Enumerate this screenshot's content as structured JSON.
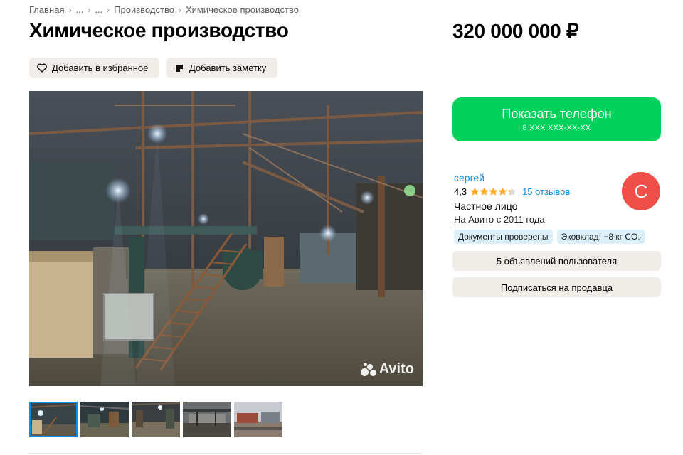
{
  "breadcrumb": {
    "items": [
      "Главная",
      "...",
      "...",
      "Производство",
      "Химическое производство"
    ],
    "separator": "›"
  },
  "listing": {
    "title": "Химическое производство",
    "price": "320 000 000 ₽"
  },
  "actions": {
    "favorite_label": "Добавить в избранное",
    "note_label": "Добавить заметку"
  },
  "gallery": {
    "watermark": "Avito",
    "thumbnail_count": 5,
    "active_index": 0
  },
  "contact": {
    "show_phone_label": "Показать телефон",
    "masked_phone": "8 XXX XXX-XX-XX"
  },
  "seller": {
    "name": "сергей",
    "avatar_letter": "С",
    "rating": "4,3",
    "rating_value": 4.3,
    "rating_max": 5,
    "reviews": "15 отзывов",
    "type": "Частное лицо",
    "since": "На Авито с 2011 года",
    "badges": [
      "Документы проверены",
      "Эковклад: −8 кг CO₂"
    ],
    "listings_button": "5 объявлений пользователя",
    "subscribe_button": "Подписаться на продавца"
  },
  "colors": {
    "accent_green": "#02d15c",
    "link_blue": "#0a8fe8",
    "star_orange": "#ffa928",
    "avatar_red": "#f04e48",
    "badge_bg": "#dcf0fb",
    "button_bg": "#f0ede8"
  },
  "icons": {
    "favorite": "heart-icon",
    "note": "note-icon",
    "rating": "star-icon"
  }
}
